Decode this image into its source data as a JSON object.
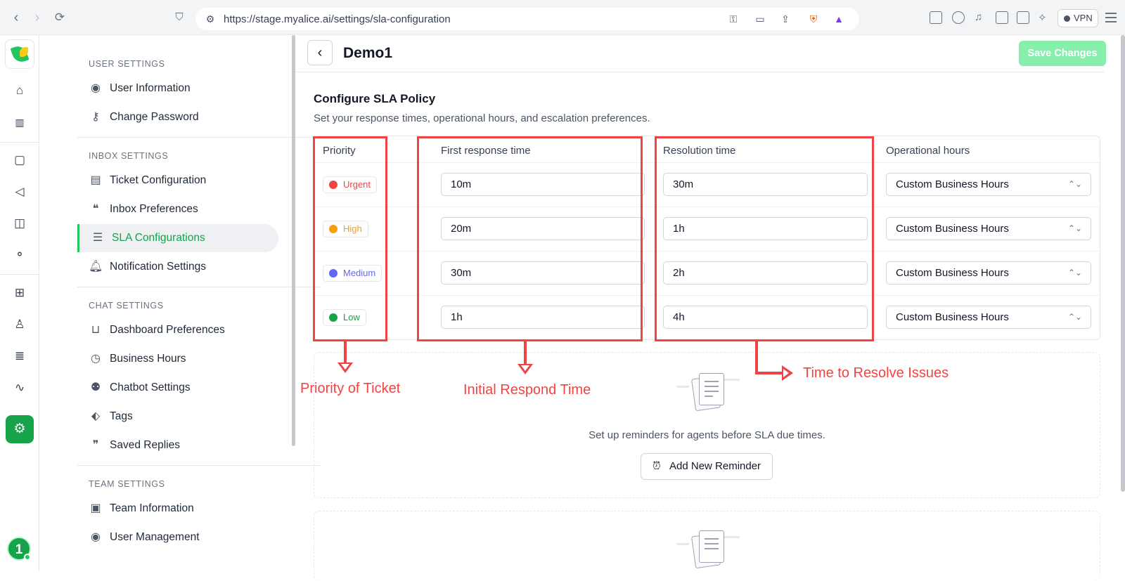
{
  "browser": {
    "url": "https://stage.myalice.ai/settings/sla-configuration",
    "vpn_label": "VPN"
  },
  "rail": {
    "avatar_initial": "1"
  },
  "sidebar": {
    "sections": [
      {
        "title": "USER SETTINGS",
        "items": [
          {
            "label": "User Information",
            "icon": "user-circle-icon"
          },
          {
            "label": "Change Password",
            "icon": "key-icon"
          }
        ]
      },
      {
        "title": "INBOX SETTINGS",
        "items": [
          {
            "label": "Ticket Configuration",
            "icon": "ticket-icon"
          },
          {
            "label": "Inbox Preferences",
            "icon": "chat-bubbles-icon"
          },
          {
            "label": "SLA Configurations",
            "icon": "table-icon",
            "active": true
          },
          {
            "label": "Notification Settings",
            "icon": "bell-icon"
          }
        ]
      },
      {
        "title": "CHAT SETTINGS",
        "items": [
          {
            "label": "Dashboard Preferences",
            "icon": "inbox-tray-icon"
          },
          {
            "label": "Business Hours",
            "icon": "clock-icon"
          },
          {
            "label": "Chatbot Settings",
            "icon": "robot-icon"
          },
          {
            "label": "Tags",
            "icon": "tag-icon"
          },
          {
            "label": "Saved Replies",
            "icon": "saved-replies-icon"
          }
        ]
      },
      {
        "title": "TEAM SETTINGS",
        "items": [
          {
            "label": "Team Information",
            "icon": "team-box-icon"
          },
          {
            "label": "User Management",
            "icon": "user-circle-icon"
          }
        ]
      }
    ]
  },
  "header": {
    "title": "Demo1",
    "save_label": "Save Changes"
  },
  "config": {
    "title": "Configure SLA Policy",
    "subtitle": "Set your response times, operational hours, and escalation preferences."
  },
  "table": {
    "headers": [
      "Priority",
      "First response time",
      "Resolution time",
      "Operational hours"
    ],
    "rows": [
      {
        "priority": "Urgent",
        "color": "#ef4444",
        "first_response": "10m",
        "resolution": "30m",
        "hours": "Custom Business Hours"
      },
      {
        "priority": "High",
        "color": "#f59e0b",
        "first_response": "20m",
        "resolution": "1h",
        "hours": "Custom Business Hours"
      },
      {
        "priority": "Medium",
        "color": "#6366f1",
        "first_response": "30m",
        "resolution": "2h",
        "hours": "Custom Business Hours"
      },
      {
        "priority": "Low",
        "color": "#16a34a",
        "first_response": "1h",
        "resolution": "4h",
        "hours": "Custom Business Hours"
      }
    ]
  },
  "reminder": {
    "text": "Set up reminders for agents before SLA due times.",
    "button_label": "Add New Reminder"
  },
  "annotations": {
    "priority": "Priority of Ticket",
    "first_response": "Initial Respond Time",
    "resolution": "Time to Resolve Issues"
  },
  "colors": {
    "brand_green": "#16a34a",
    "save_disabled": "#86efac",
    "annotation_red": "#ef4444"
  }
}
